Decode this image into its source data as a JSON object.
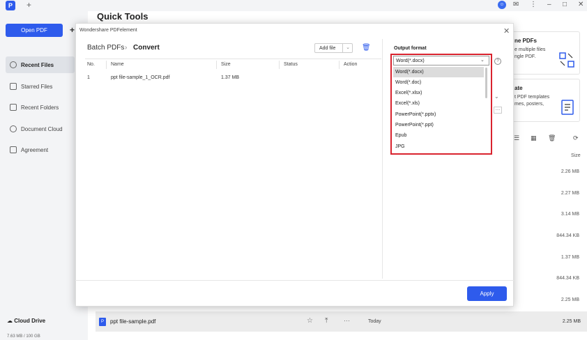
{
  "app": {
    "logo_letter": "P",
    "new_tab": "+"
  },
  "window_controls": {
    "avatar": "☺",
    "feedback": "✉",
    "menu": "⋮",
    "minimize": "–",
    "maximize": "□",
    "close": "✕"
  },
  "sidebar": {
    "open_pdf": "Open PDF",
    "plus": "+",
    "items": [
      {
        "label": "Recent Files",
        "active": true
      },
      {
        "label": "Starred Files",
        "active": false
      },
      {
        "label": "Recent Folders",
        "active": false
      },
      {
        "label": "Document Cloud",
        "active": false
      },
      {
        "label": "Agreement",
        "active": false
      }
    ],
    "cloud_drive": "Cloud Drive",
    "storage": "7.63 MB / 100 GB"
  },
  "main": {
    "title": "Quick Tools",
    "card1": {
      "title": "ne PDFs",
      "line1": "e multiple files",
      "line2": "ngle PDF."
    },
    "card2": {
      "title": "ate",
      "line1": "t PDF templates",
      "line2": "mes, posters,"
    },
    "size_header": "Size",
    "sizes": [
      "2.26 MB",
      "2.27 MB",
      "3.14 MB",
      "844.34 KB",
      "1.37 MB",
      "844.34 KB",
      "2.25 MB"
    ],
    "bottom_file": {
      "name": "ppt file-sample.pdf",
      "date": "Today",
      "size": "2.25 MB",
      "more": "···"
    }
  },
  "dialog": {
    "title": "Wondershare PDFelement",
    "close": "✕",
    "breadcrumb": {
      "batch": "Batch PDFs",
      "sep": "›",
      "current": "Convert"
    },
    "add_file": "Add file",
    "columns": [
      "No.",
      "Name",
      "Size",
      "Status",
      "Action"
    ],
    "rows": [
      {
        "no": "1",
        "name": "ppt file-sample_1_OCR.pdf",
        "size": "1.37 MB",
        "status": "",
        "action": ""
      }
    ],
    "apply": "Apply"
  },
  "output": {
    "label": "Output format",
    "selected": "Word(*.docx)",
    "options": [
      "Word(*.docx)",
      "Word(*.doc)",
      "Excel(*.xlsx)",
      "Excel(*.xls)",
      "PowerPoint(*.pptx)",
      "PowerPoint(*.ppt)",
      "Epub",
      "JPG"
    ]
  },
  "colors": {
    "accent": "#2e5bec",
    "highlight_border": "#d9232e"
  }
}
